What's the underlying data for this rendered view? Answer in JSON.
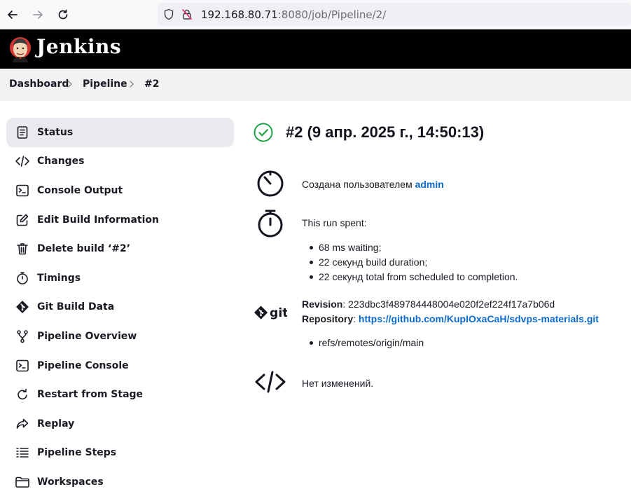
{
  "browser": {
    "url_host": "192.168.80.71",
    "url_rest": ":8080/job/Pipeline/2/"
  },
  "header": {
    "title": "Jenkins"
  },
  "breadcrumb": {
    "items": [
      "Dashboard",
      "Pipeline",
      "#2"
    ]
  },
  "sidebar": {
    "items": [
      {
        "label": "Status",
        "icon": "document-icon",
        "active": true
      },
      {
        "label": "Changes",
        "icon": "code-icon"
      },
      {
        "label": "Console Output",
        "icon": "terminal-icon"
      },
      {
        "label": "Edit Build Information",
        "icon": "edit-icon"
      },
      {
        "label": "Delete build ‘#2’",
        "icon": "trash-icon"
      },
      {
        "label": "Timings",
        "icon": "stopwatch-icon"
      },
      {
        "label": "Git Build Data",
        "icon": "git-icon"
      },
      {
        "label": "Pipeline Overview",
        "icon": "branch-icon"
      },
      {
        "label": "Pipeline Console",
        "icon": "terminal-icon"
      },
      {
        "label": "Restart from Stage",
        "icon": "restart-icon"
      },
      {
        "label": "Replay",
        "icon": "replay-icon"
      },
      {
        "label": "Pipeline Steps",
        "icon": "list-icon"
      },
      {
        "label": "Workspaces",
        "icon": "folder-icon"
      }
    ]
  },
  "main": {
    "build_title": "#2 (9 апр. 2025 г., 14:50:13)",
    "started_by_prefix": "Создана пользователем ",
    "started_by_user": "admin",
    "run_spent_label": "This run spent:",
    "run_spent_items": [
      "68 ms waiting;",
      "22 секунд build duration;",
      "22 секунд total from scheduled to completion."
    ],
    "revision_label": "Revision",
    "revision_value": ": 223dbc3f489784448004e020f2ef224f17a7b06d",
    "repository_label": "Repository",
    "repository_sep": ": ",
    "repository_url": "https://github.com/KupIOxaCaH/sdvps-materials.git",
    "refs": [
      "refs/remotes/origin/main"
    ],
    "changes_text": "Нет изменений."
  },
  "colors": {
    "accent_link": "#0b6bcb",
    "success": "#1ea446",
    "header_bg": "#000000",
    "breadcrumb_bg": "#f2f2f3"
  }
}
